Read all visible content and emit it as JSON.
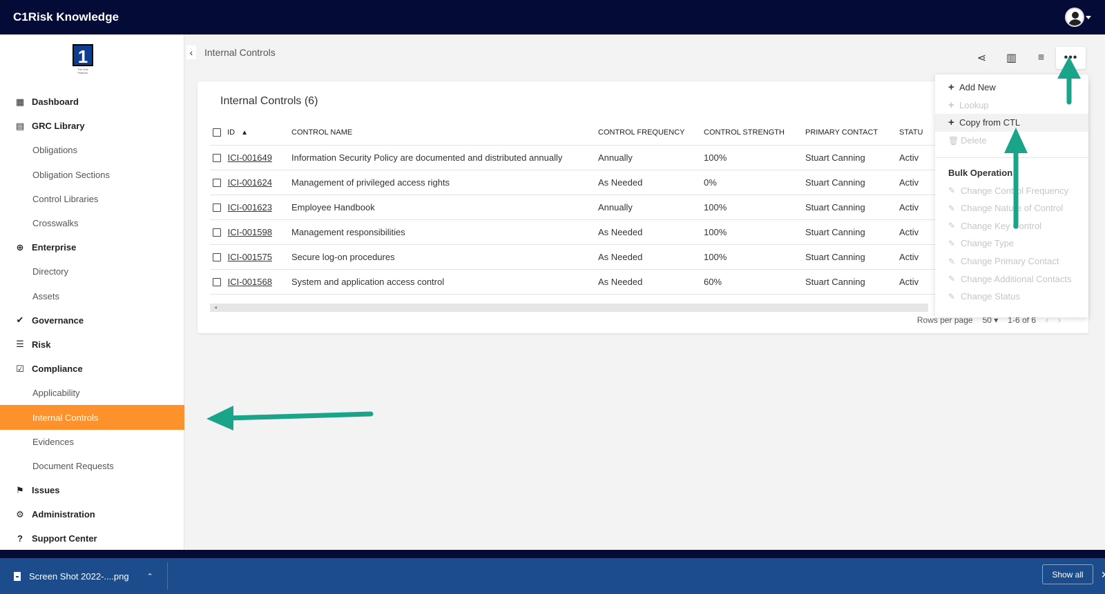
{
  "app": {
    "title": "C1Risk Knowledge"
  },
  "logo": {
    "glyph": "1",
    "tagline": "The One Platform"
  },
  "sidebar": {
    "items": [
      {
        "label": "Dashboard",
        "icon": "dashboard-icon",
        "glyph": "▦"
      },
      {
        "label": "GRC Library",
        "icon": "book-icon",
        "glyph": "▤"
      },
      {
        "label": "Obligations"
      },
      {
        "label": "Obligation Sections"
      },
      {
        "label": "Control Libraries"
      },
      {
        "label": "Crosswalks"
      },
      {
        "label": "Enterprise",
        "icon": "globe-icon",
        "glyph": "⊕"
      },
      {
        "label": "Directory"
      },
      {
        "label": "Assets"
      },
      {
        "label": "Governance",
        "icon": "check-double-icon",
        "glyph": "✔"
      },
      {
        "label": "Risk",
        "icon": "list-icon",
        "glyph": "☰"
      },
      {
        "label": "Compliance",
        "icon": "clipboard-check-icon",
        "glyph": "☑"
      },
      {
        "label": "Applicability"
      },
      {
        "label": "Internal Controls"
      },
      {
        "label": "Evidences"
      },
      {
        "label": "Document Requests"
      },
      {
        "label": "Issues",
        "icon": "flag-icon",
        "glyph": "⚑"
      },
      {
        "label": "Administration",
        "icon": "gear-icon",
        "glyph": "⚙"
      },
      {
        "label": "Support Center",
        "icon": "question-icon",
        "glyph": "?"
      }
    ]
  },
  "breadcrumb": {
    "back": "‹",
    "label": "Internal Controls"
  },
  "toolbar": {
    "share": "⋖",
    "columns": "▥",
    "filter": "≡",
    "more": "•••"
  },
  "card": {
    "title": "Internal Controls (6)",
    "columns": [
      "ID",
      "CONTROL NAME",
      "CONTROL FREQUENCY",
      "CONTROL STRENGTH",
      "PRIMARY CONTACT",
      "STATU"
    ],
    "rows": [
      {
        "id": "ICI-001649",
        "name": "Information Security Policy are documented and distributed annually",
        "frequency": "Annually",
        "strength": "100%",
        "contact": "Stuart Canning",
        "status": "Activ"
      },
      {
        "id": "ICI-001624",
        "name": "Management of privileged access rights",
        "frequency": "As Needed",
        "strength": "0%",
        "contact": "Stuart Canning",
        "status": "Activ"
      },
      {
        "id": "ICI-001623",
        "name": "Employee Handbook",
        "frequency": "Annually",
        "strength": "100%",
        "contact": "Stuart Canning",
        "status": "Activ"
      },
      {
        "id": "ICI-001598",
        "name": "Management responsibilities",
        "frequency": "As Needed",
        "strength": "100%",
        "contact": "Stuart Canning",
        "status": "Activ"
      },
      {
        "id": "ICI-001575",
        "name": "Secure log-on procedures",
        "frequency": "As Needed",
        "strength": "100%",
        "contact": "Stuart Canning",
        "status": "Activ"
      },
      {
        "id": "ICI-001568",
        "name": "System and application access control",
        "frequency": "As Needed",
        "strength": "60%",
        "contact": "Stuart Canning",
        "status": "Activ"
      }
    ],
    "pager": {
      "rows_label": "Rows per page",
      "rows_value": "50 ▾",
      "range": "1-6 of 6",
      "prev": "‹",
      "next": "›"
    }
  },
  "menu": {
    "items": [
      {
        "label": "Add New",
        "disabled": false
      },
      {
        "label": "Lookup",
        "disabled": true
      },
      {
        "label": "Copy from CTL",
        "disabled": false
      },
      {
        "label": "Delete",
        "disabled": true
      }
    ],
    "bulk_heading": "Bulk Operation",
    "bulk_items": [
      "Change Control Frequency",
      "Change Nature of Control",
      "Change Key Control",
      "Change Type",
      "Change Primary Contact",
      "Change Additional Contacts",
      "Change Status"
    ]
  },
  "downloads": {
    "file": "Screen Shot 2022-....png",
    "show_all": "Show all",
    "close": "✕"
  },
  "colors": {
    "topbar": "#030b36",
    "active_nav": "#fd922d",
    "arrow": "#1aa58a",
    "download_bar": "#1c4c8b"
  }
}
